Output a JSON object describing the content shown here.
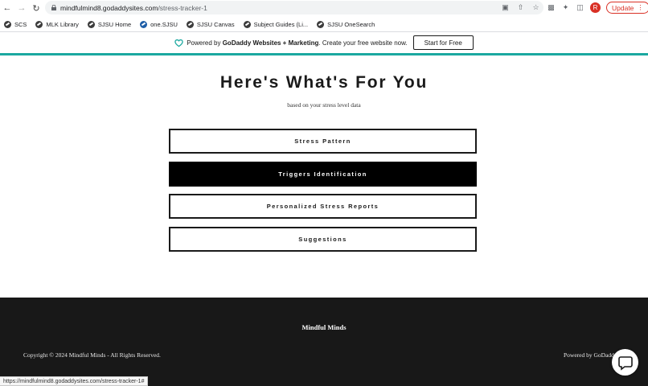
{
  "browser": {
    "url_host": "mindfulmind8.godaddysites.com",
    "url_path": "/stress-tracker-1",
    "avatar_letter": "R",
    "update_label": "Update",
    "status_url": "https://mindfulmind8.godaddysites.com/stress-tracker-1#"
  },
  "bookmarks": [
    {
      "label": "SCS",
      "icon": "globe-icon"
    },
    {
      "label": "MLK Library",
      "icon": "globe-icon"
    },
    {
      "label": "SJSU Home",
      "icon": "globe-icon"
    },
    {
      "label": "one.SJSU",
      "icon": "sjsu-icon"
    },
    {
      "label": "SJSU Canvas",
      "icon": "globe-icon"
    },
    {
      "label": "Subject Guides (Li...",
      "icon": "globe-icon"
    },
    {
      "label": "SJSU OneSearch",
      "icon": "globe-icon"
    }
  ],
  "banner": {
    "prefix": "Powered by ",
    "bold": "GoDaddy Websites + Marketing",
    "suffix": ". Create your free website now.",
    "cta": "Start for Free"
  },
  "page": {
    "title": "Here's What's For You",
    "subtitle": "based on your stress level data",
    "buttons": [
      {
        "label": "Stress Pattern",
        "active": false
      },
      {
        "label": "Triggers Identification",
        "active": true
      },
      {
        "label": "Personalized Stress Reports",
        "active": false
      },
      {
        "label": "Suggestions",
        "active": false
      }
    ]
  },
  "footer": {
    "brand": "Mindful Minds",
    "copyright": "Copyright © 2024 Mindful Minds - All Rights Reserved.",
    "powered": "Powered by GoDaddy"
  },
  "colors": {
    "accent_teal": "#1ba8a0",
    "footer_bg": "#181818",
    "active_button_bg": "#000000",
    "update_red": "#d93025"
  }
}
